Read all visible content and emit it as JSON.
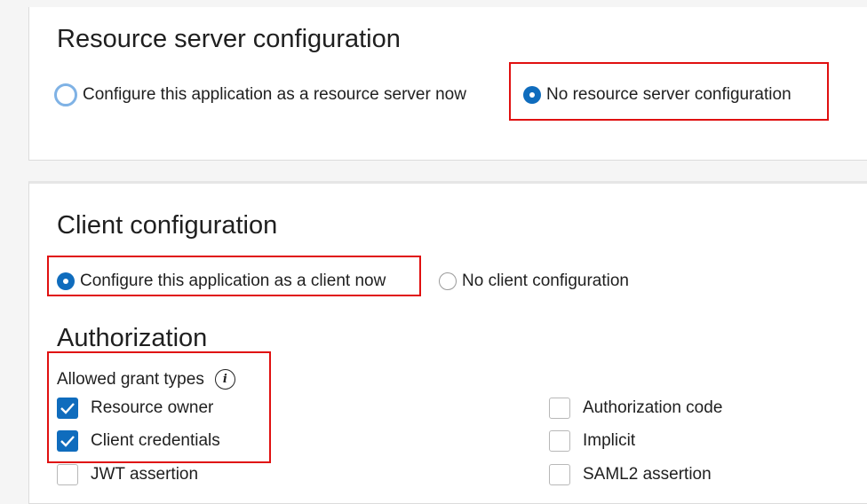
{
  "resource_server": {
    "title": "Resource server configuration",
    "options": [
      {
        "label": "Configure this application as a resource server now",
        "selected": false
      },
      {
        "label": "No resource server configuration",
        "selected": true
      }
    ]
  },
  "client": {
    "title": "Client configuration",
    "options": [
      {
        "label": "Configure this application as a client now",
        "selected": true
      },
      {
        "label": "No client configuration",
        "selected": false
      }
    ]
  },
  "authorization": {
    "title": "Authorization",
    "grant_types_label": "Allowed grant types",
    "info_icon_glyph": "i",
    "grant_types": [
      {
        "label": "Resource owner",
        "checked": true
      },
      {
        "label": "Client credentials",
        "checked": true
      },
      {
        "label": "JWT assertion",
        "checked": false
      },
      {
        "label": "Authorization code",
        "checked": false
      },
      {
        "label": "Implicit",
        "checked": false
      },
      {
        "label": "SAML2 assertion",
        "checked": false
      }
    ]
  },
  "colors": {
    "accent": "#0f6cbd",
    "highlight": "#e01010"
  }
}
